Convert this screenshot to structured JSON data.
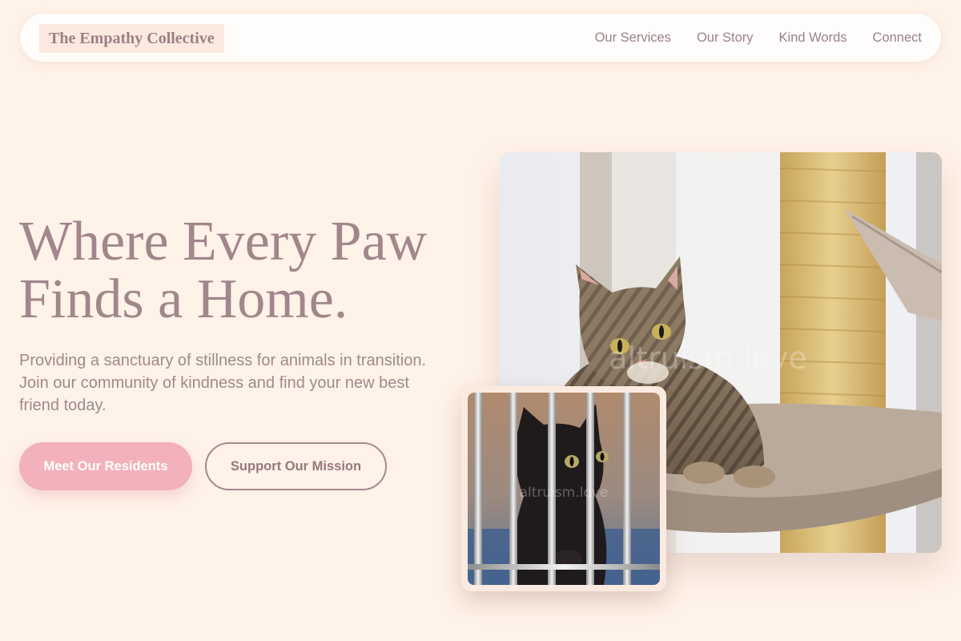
{
  "brand": {
    "name": "The Empathy Collective"
  },
  "nav": {
    "links": [
      "Our Services",
      "Our Story",
      "Kind Words",
      "Connect"
    ]
  },
  "hero": {
    "title_line1": "Where Every Paw",
    "title_line2": "Finds a Home.",
    "subtitle": "Providing a sanctuary of stillness for animals in transition. Join our community of kindness and find your new best friend today.",
    "primary_cta": "Meet Our Residents",
    "secondary_cta": "Support Our Mission"
  },
  "images": {
    "main_watermark": "altruism.love",
    "small_watermark": "altruism.love"
  },
  "colors": {
    "background": "#fff2e8",
    "accent_pink": "#f2b1bb",
    "text_mauve": "#a1868b"
  }
}
